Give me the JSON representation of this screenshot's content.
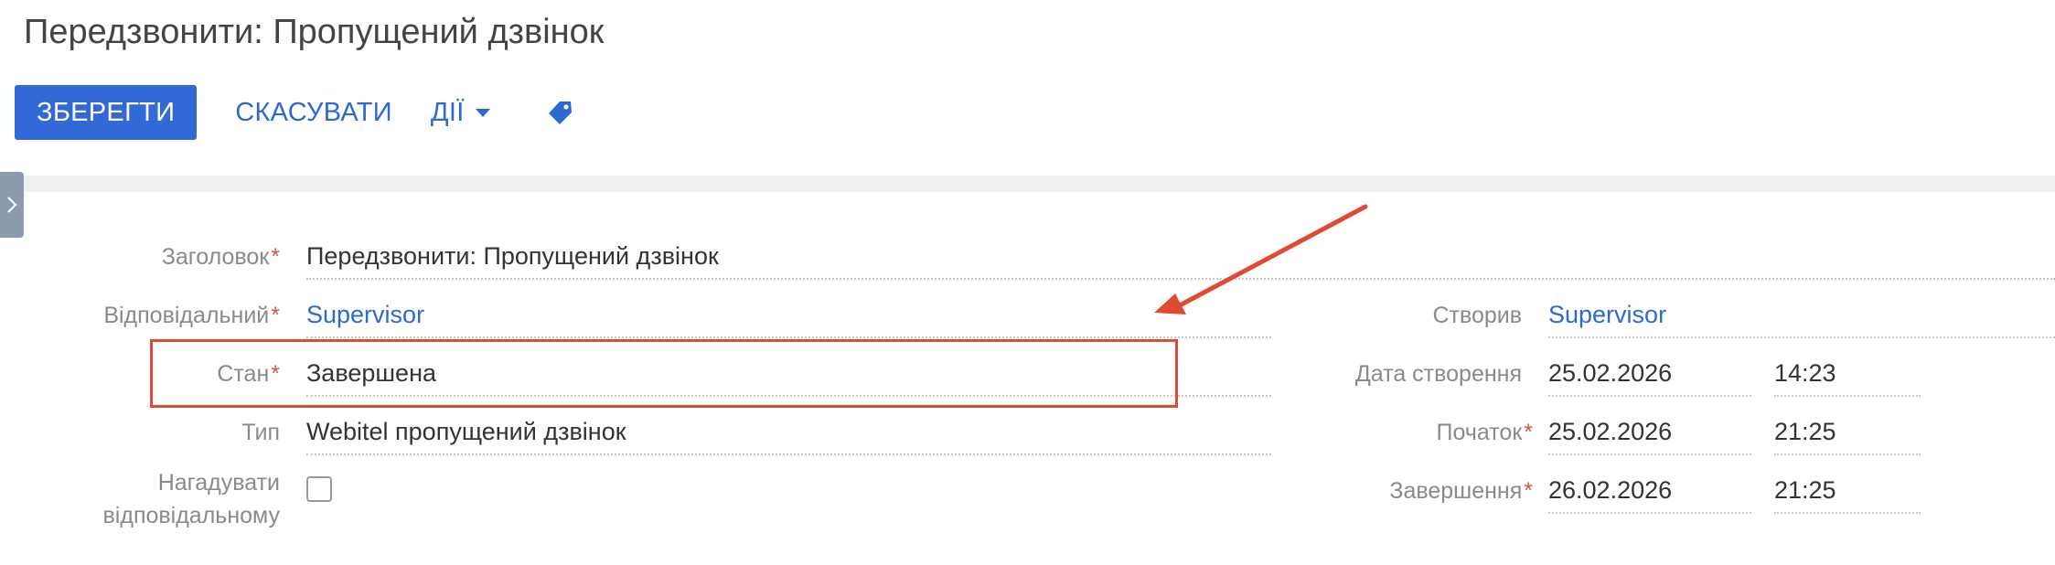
{
  "page": {
    "title": "Передзвонити: Пропущений дзвінок"
  },
  "toolbar": {
    "save_label": "ЗБЕРЕГТИ",
    "cancel_label": "СКАСУВАТИ",
    "actions_label": "ДІЇ",
    "tag_icon": "tag-icon"
  },
  "form": {
    "title_field": {
      "label": "Заголовок",
      "required": "*",
      "value": "Передзвонити: Пропущений дзвінок"
    },
    "owner_field": {
      "label": "Відповідальний",
      "required": "*",
      "value": "Supervisor"
    },
    "status_field": {
      "label": "Стан",
      "required": "*",
      "value": "Завершена"
    },
    "type_field": {
      "label": "Тип",
      "value": "Webitel пропущений дзвінок"
    },
    "remind_field": {
      "label_line1": "Нагадувати",
      "label_line2": "відповідальному",
      "checked": false
    },
    "created_by_field": {
      "label": "Створив",
      "value": "Supervisor"
    },
    "created_on_field": {
      "label": "Дата створення",
      "date": "25.02.2026",
      "time": "14:23"
    },
    "start_field": {
      "label": "Початок",
      "required": "*",
      "date": "25.02.2026",
      "time": "21:25"
    },
    "end_field": {
      "label": "Завершення",
      "required": "*",
      "date": "26.02.2026",
      "time": "21:25"
    }
  },
  "colors": {
    "primary": "#3369d6",
    "link": "#2d6ad0",
    "required": "#e0533b",
    "annotation": "#e04a32"
  }
}
